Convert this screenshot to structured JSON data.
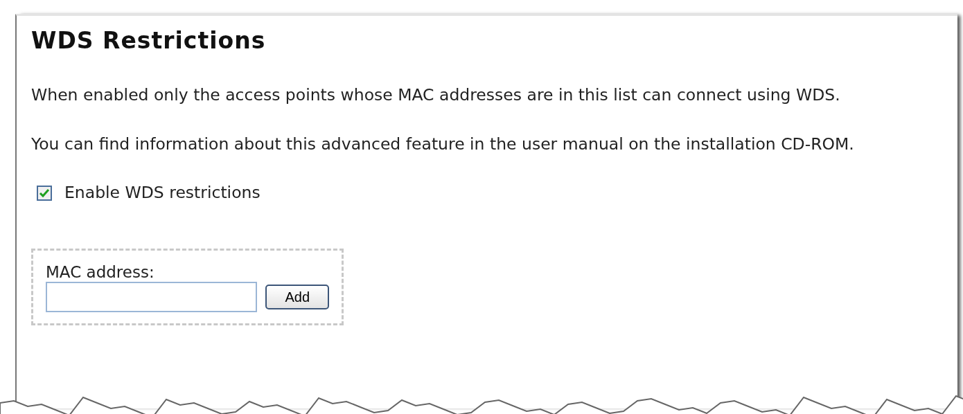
{
  "title": "WDS Restrictions",
  "paragraphs": [
    "When enabled only the access points whose MAC addresses are in this list can connect using WDS.",
    "You can find information about this advanced feature in the user manual on the installation CD-ROM."
  ],
  "enable_checkbox": {
    "label": "Enable WDS restrictions",
    "checked": true
  },
  "mac_form": {
    "label": "MAC address:",
    "button": "Add"
  }
}
